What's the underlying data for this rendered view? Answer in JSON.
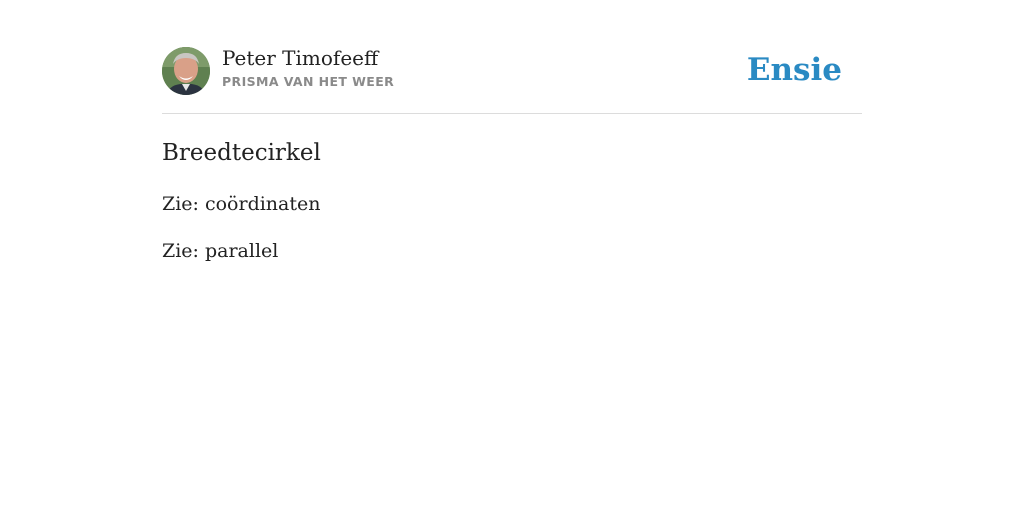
{
  "header": {
    "author_name": "Peter Timofeeff",
    "source_name": "PRISMA VAN HET WEER",
    "logo_text": "Ensie",
    "logo_color": "#2a8ac3"
  },
  "entry": {
    "title": "Breedtecirkel",
    "references": [
      {
        "prefix": "Zie: ",
        "link": "coördinaten"
      },
      {
        "prefix": "Zie: ",
        "link": "parallel"
      }
    ]
  }
}
